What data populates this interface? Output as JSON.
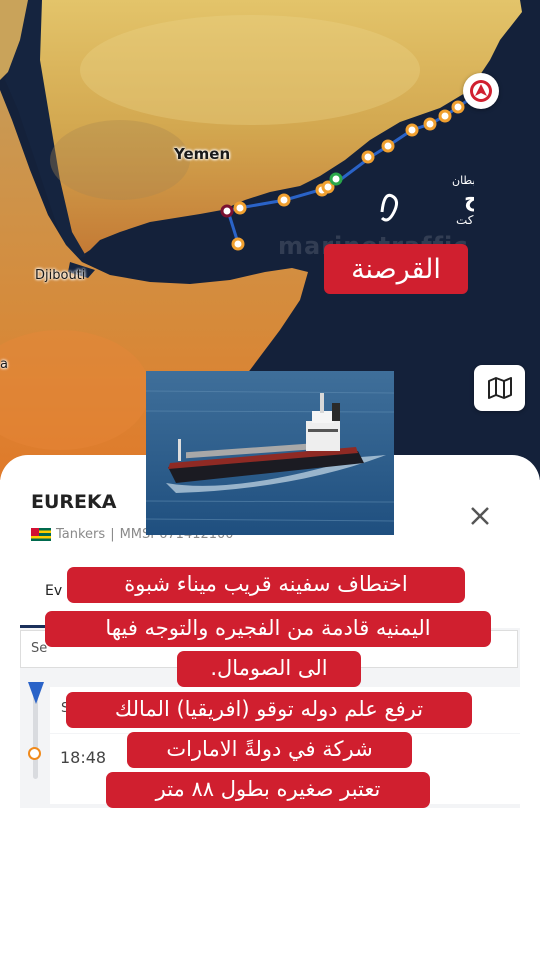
{
  "map": {
    "country_labels": {
      "yemen": "Yemen",
      "djibouti": "Djibouti",
      "partial": "a"
    },
    "watermark": "marinetraffic",
    "colors": {
      "sea": "#14213a",
      "land": "#d8b45a",
      "track": "#2a63c8",
      "track_points": "#f0a030"
    }
  },
  "overlay": {
    "banner": "القرصنة",
    "logo_lines": [
      "القبطان",
      "ممدوح",
      "الساكت"
    ]
  },
  "controls": {
    "compass_icon": "compass-icon",
    "map_layers_icon": "map-icon"
  },
  "vessel": {
    "name": "EUREKA",
    "type": "Tankers",
    "separator": "|",
    "mmsi_label": "MMSI",
    "mmsi_value": "671412100",
    "flag_icon": "togo-flag-icon"
  },
  "tabs": {
    "events_label": "Ev"
  },
  "events": {
    "search_prefix": "Se",
    "first_prefix": "S",
    "time": "18:48"
  },
  "caption": {
    "lines": [
      "اختطاف سفينه قريب ميناء شبوة",
      "اليمنيه قادمة من الفجيره والتوجه فيها",
      "الى الصومال.",
      "ترفع علم دوله توقو (افريقيا) المالك",
      "شركة في دولةً الامارات",
      "تعتبر صغيره بطول ٨٨ متر"
    ]
  }
}
